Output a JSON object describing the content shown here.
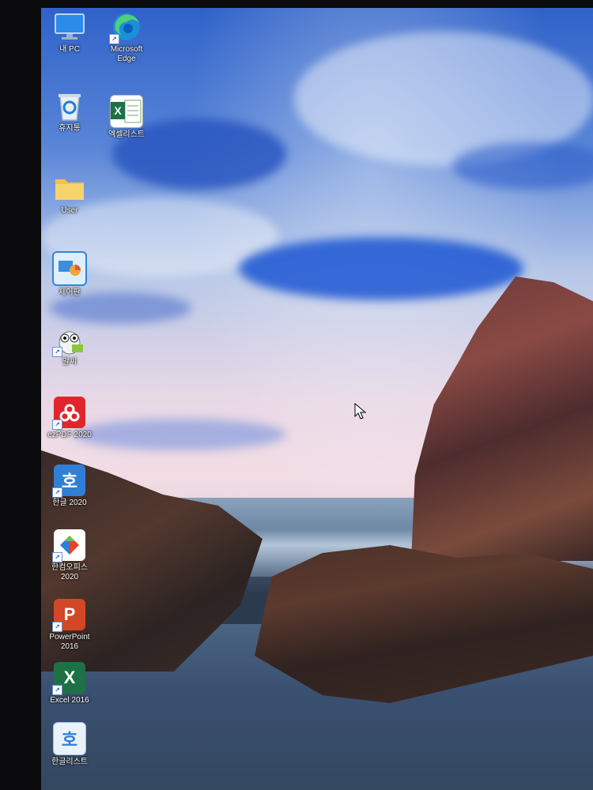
{
  "desktop": {
    "icons": [
      {
        "label": "내 PC"
      },
      {
        "label": "Microsoft\nEdge"
      },
      {
        "label": "휴지통"
      },
      {
        "label": "엑셀리스트"
      },
      {
        "label": "User"
      },
      {
        "label": "제어판"
      },
      {
        "label": "알씨"
      },
      {
        "label": "ezPDF 2020"
      },
      {
        "label": "한글 2020"
      },
      {
        "label": "한컴오피스\n2020"
      },
      {
        "label": "PowerPoint\n2016"
      },
      {
        "label": "Excel 2016"
      },
      {
        "label": "한글리스트"
      }
    ]
  },
  "glyphs": {
    "excel": "X",
    "powerpoint": "P",
    "hangul": "호",
    "shortcut": "↗"
  },
  "colors": {
    "excel_green": "#1e7145",
    "powerpoint_red": "#d24726",
    "hangul_blue": "#2f7fd6",
    "pdf_red": "#e0262c",
    "folder_yellow": "#f2c14e"
  }
}
